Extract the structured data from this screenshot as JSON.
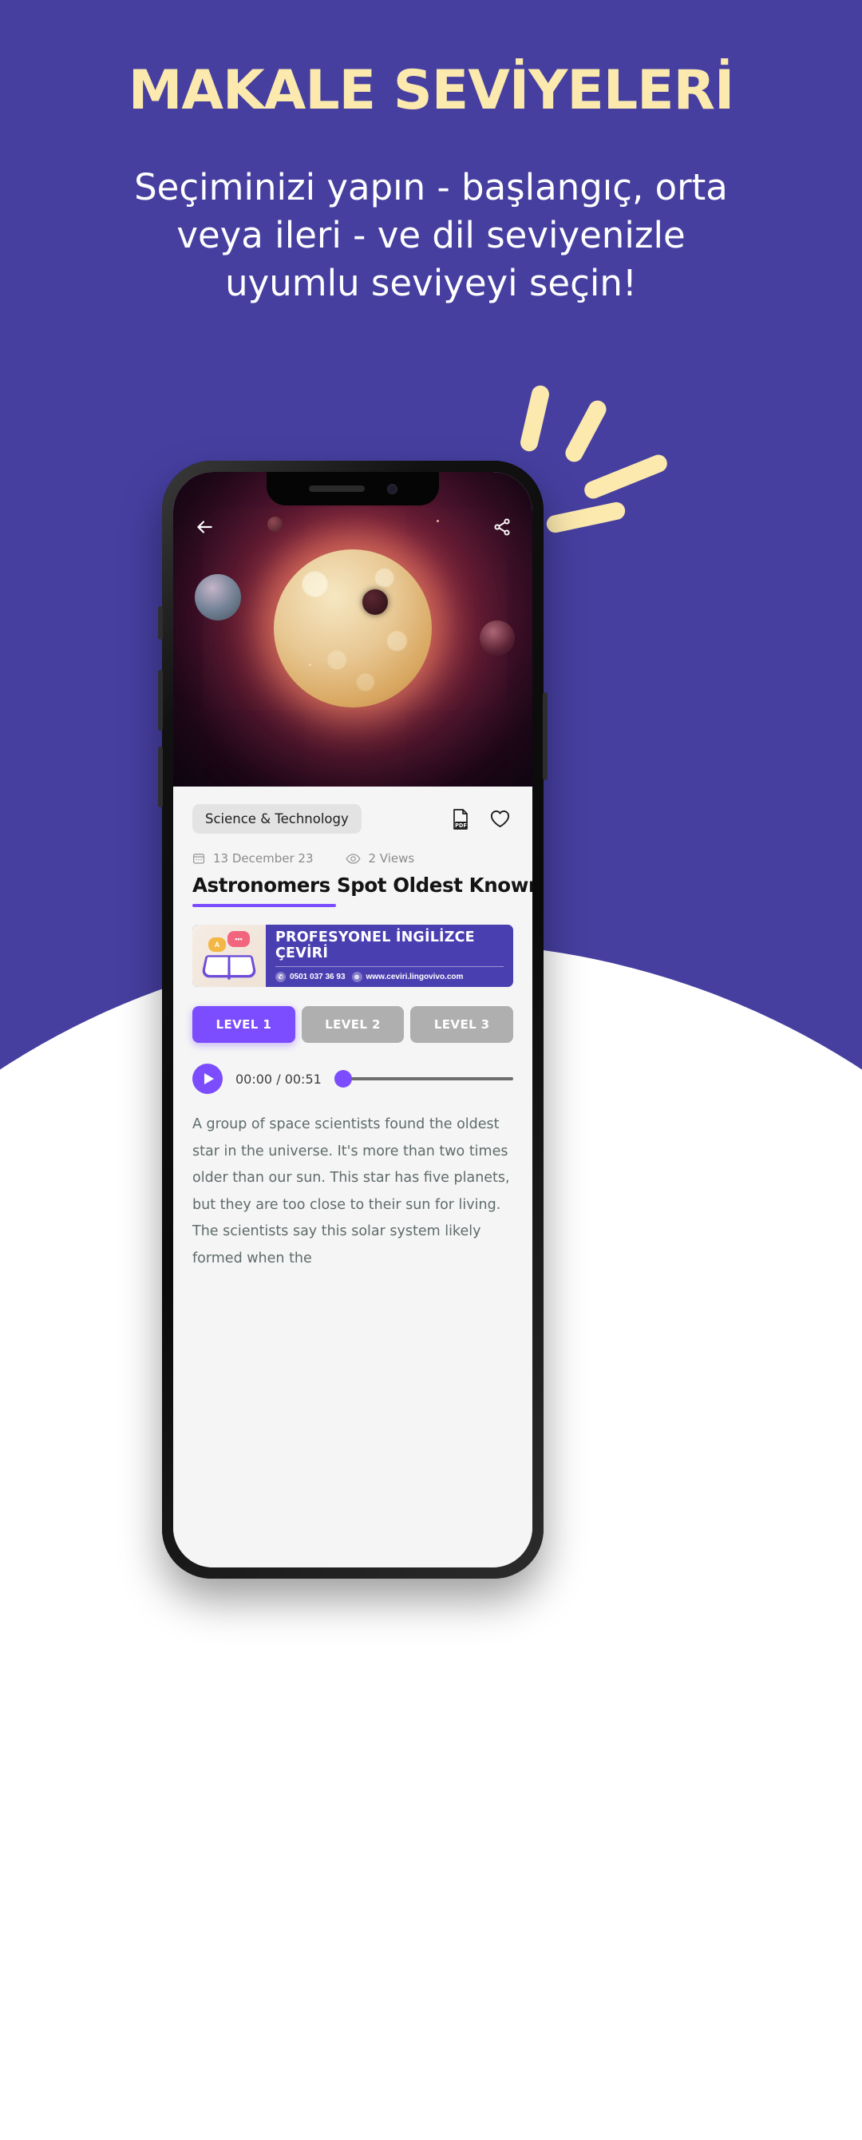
{
  "promo": {
    "title": "MAKALE SEVİYELERİ",
    "subtitle": "Seçiminizi yapın - başlangıç, orta veya ileri - ve dil seviyenizle uyumlu seviyeyi seçin!",
    "title_color": "#FBE9AE",
    "background_color": "#463FA0"
  },
  "app": {
    "nav": {
      "back_icon": "arrow-left-icon",
      "share_icon": "share-icon"
    },
    "hero": {
      "image_alt": "star-and-planets-space-illustration"
    },
    "article": {
      "category": "Science & Technology",
      "pdf_icon": "pdf-file-icon",
      "favorite_icon": "heart-icon",
      "calendar_icon": "calendar-icon",
      "date": "13 December 23",
      "views_icon": "eye-icon",
      "views": "2 Views",
      "title": "Astronomers Spot Oldest Known Star",
      "accent_color": "#7C4DFF",
      "body": "A group of space scientists found the oldest star in the universe. It's more than two times older than our sun. This star has five planets, but they are too close to their sun for living. The scientists say this solar system likely formed when the"
    },
    "banner": {
      "headline": "PROFESYONEL İNGİLİZCE ÇEVİRİ",
      "phone_icon": "phone-icon",
      "phone": "0501 037 36 93",
      "globe_icon": "globe-icon",
      "website": "www.ceviri.lingovivo.com",
      "bubble_a": "A",
      "bubble_dots": "•••"
    },
    "levels": [
      {
        "label": "LEVEL 1",
        "state": "active"
      },
      {
        "label": "LEVEL 2",
        "state": "idle"
      },
      {
        "label": "LEVEL 3",
        "state": "idle"
      }
    ],
    "audio": {
      "play_icon": "play-icon",
      "current_time": "00:00",
      "separator": "/",
      "duration": "00:51",
      "progress_percent": 0
    }
  }
}
